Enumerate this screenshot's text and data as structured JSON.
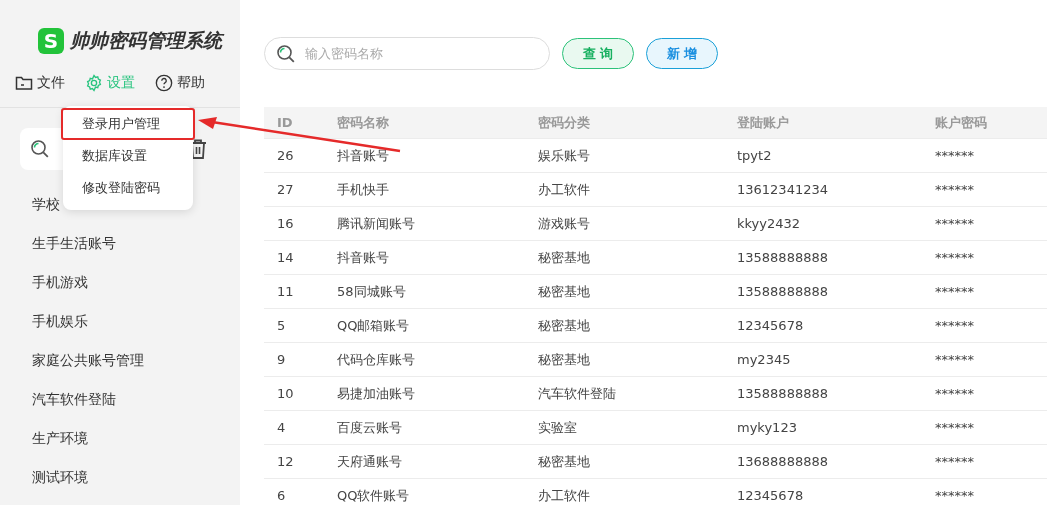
{
  "app": {
    "logo": "S",
    "title": "帅帅密码管理系统"
  },
  "menu": [
    {
      "label": "文件",
      "selected": false
    },
    {
      "label": "设置",
      "selected": true
    },
    {
      "label": "帮助",
      "selected": false
    }
  ],
  "dropdown": [
    {
      "label": "登录用户管理",
      "highlighted": true
    },
    {
      "label": "数据库设置",
      "highlighted": false
    },
    {
      "label": "修改登陆密码",
      "highlighted": false
    }
  ],
  "categories": [
    "学校",
    "生手生活账号",
    "手机游戏",
    "手机娱乐",
    "家庭公共账号管理",
    "汽车软件登陆",
    "生产环境",
    "测试环境"
  ],
  "search": {
    "placeholder": "输入密码名称"
  },
  "buttons": [
    {
      "label": "查 询",
      "kind": "query"
    },
    {
      "label": "新 增",
      "kind": "add"
    }
  ],
  "table": {
    "columns": [
      "ID",
      "密码名称",
      "密码分类",
      "登陆账户",
      "账户密码"
    ],
    "rows": [
      [
        "26",
        "抖音账号",
        "娱乐账号",
        "tpyt2",
        "******"
      ],
      [
        "27",
        "手机快手",
        "办工软件",
        "13612341234",
        "******"
      ],
      [
        "16",
        "腾讯新闻账号",
        "游戏账号",
        "kkyy2432",
        "******"
      ],
      [
        "14",
        "抖音账号",
        "秘密基地",
        "13588888888",
        "******"
      ],
      [
        "11",
        "58同城账号",
        "秘密基地",
        "13588888888",
        "******"
      ],
      [
        "5",
        "QQ邮箱账号",
        "秘密基地",
        "12345678",
        "******"
      ],
      [
        "9",
        "代码仓库账号",
        "秘密基地",
        "my2345",
        "******"
      ],
      [
        "10",
        "易捷加油账号",
        "汽车软件登陆",
        "13588888888",
        "******"
      ],
      [
        "4",
        "百度云账号",
        "实验室",
        "myky123",
        "******"
      ],
      [
        "12",
        "天府通账号",
        "秘密基地",
        "13688888888",
        "******"
      ],
      [
        "6",
        "QQ软件账号",
        "办工软件",
        "12345678",
        "******"
      ]
    ]
  }
}
